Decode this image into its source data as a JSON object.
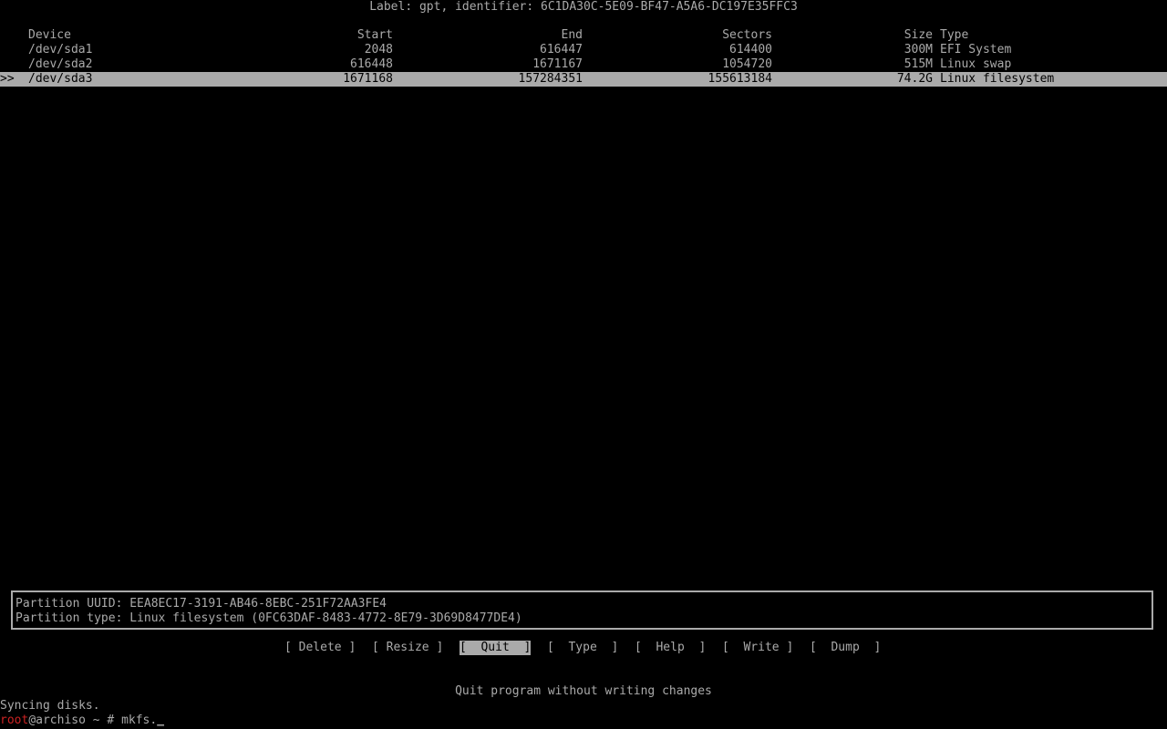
{
  "disk_label": "Label: gpt, identifier: 6C1DA30C-5E09-BF47-A5A6-DC197E35FFC3",
  "table": {
    "columns": {
      "device": "Device",
      "start": "Start",
      "end": "End",
      "sectors": "Sectors",
      "size": "Size",
      "type": "Type"
    },
    "rows": [
      {
        "marker": "",
        "device": "/dev/sda1",
        "start": "2048",
        "end": "616447",
        "sectors": "614400",
        "size": "300M",
        "type": "EFI System",
        "selected": false
      },
      {
        "marker": "",
        "device": "/dev/sda2",
        "start": "616448",
        "end": "1671167",
        "sectors": "1054720",
        "size": "515M",
        "type": "Linux swap",
        "selected": false
      },
      {
        "marker": ">>",
        "device": "/dev/sda3",
        "start": "1671168",
        "end": "157284351",
        "sectors": "155613184",
        "size": "74.2G",
        "type": "Linux filesystem",
        "selected": true
      }
    ]
  },
  "info": {
    "uuid_line": "Partition UUID: EEA8EC17-3191-AB46-8EBC-251F72AA3FE4",
    "type_line": "Partition type: Linux filesystem (0FC63DAF-8483-4772-8E79-3D69D8477DE4)"
  },
  "menu": {
    "delete": "[ Delete ]",
    "resize": "[ Resize ]",
    "quit": "[  Quit  ]",
    "type": "[  Type  ]",
    "help": "[  Help  ]",
    "write": "[  Write ]",
    "dump": "[  Dump  ]",
    "active": "quit"
  },
  "hint": "Quit program without writing changes",
  "console": {
    "syncing": "Syncing disks.",
    "prompt_user": "root",
    "prompt_rest": "@archiso ~ # ",
    "command": "mkfs.",
    "cursor": "_"
  },
  "colors": {
    "background": "#000000",
    "foreground": "#aaaaaa",
    "prompt_user": "#cc2222"
  }
}
